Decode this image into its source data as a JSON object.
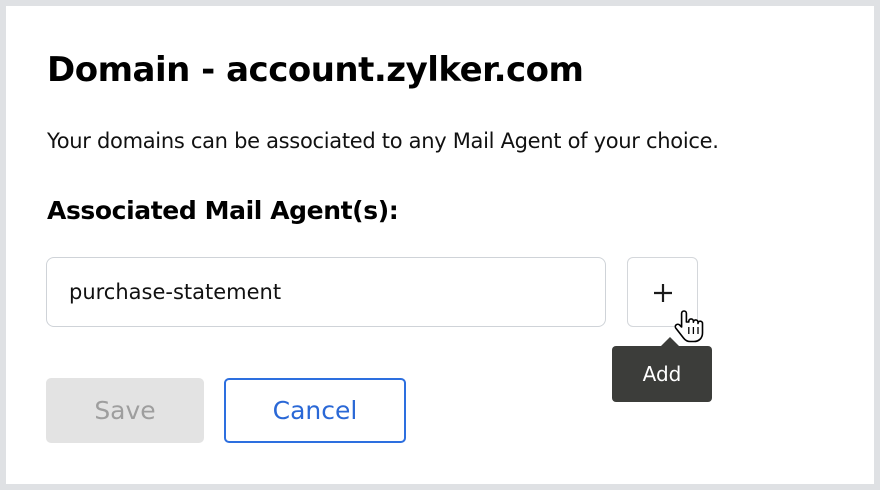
{
  "dialog": {
    "title": "Domain - account.zylker.com",
    "description": "Your domains can be associated to any Mail Agent of your choice.",
    "agents_label": "Associated Mail Agent(s):"
  },
  "agent_input": {
    "value": "purchase-statement"
  },
  "add_button": {
    "icon": "plus-icon",
    "tooltip": "Add"
  },
  "actions": {
    "save_label": "Save",
    "cancel_label": "Cancel"
  },
  "colors": {
    "save_disabled_bg": "#e3e3e3",
    "cancel_accent": "#2d6fdf",
    "tooltip_bg": "#3c3d3a"
  }
}
